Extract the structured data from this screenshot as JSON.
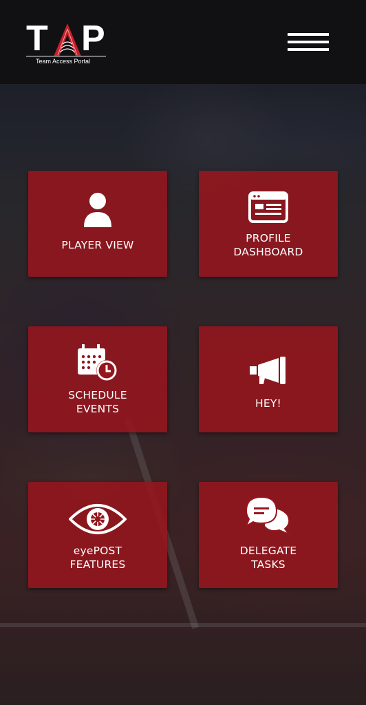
{
  "header": {
    "logo_letters": {
      "t": "T",
      "a": "A",
      "p": "P"
    },
    "logo_tagline": "Team Access Portal",
    "menu_icon": "hamburger-menu-icon"
  },
  "tiles": [
    {
      "label": "PLAYER VIEW",
      "icon": "user-icon"
    },
    {
      "label": "PROFILE\nDASHBOARD",
      "icon": "profile-card-icon"
    },
    {
      "label": "SCHEDULE\nEVENTS",
      "icon": "calendar-clock-icon"
    },
    {
      "label": "HEY!",
      "icon": "megaphone-icon"
    },
    {
      "label": "eyePOST\nFEATURES",
      "icon": "eye-icon"
    },
    {
      "label": "DELEGATE\nTASKS",
      "icon": "chat-bubbles-icon"
    }
  ],
  "colors": {
    "header_bg": "#111114",
    "tile_bg": "#96161e",
    "logo_accent": "#c8202a",
    "text": "#ffffff"
  }
}
